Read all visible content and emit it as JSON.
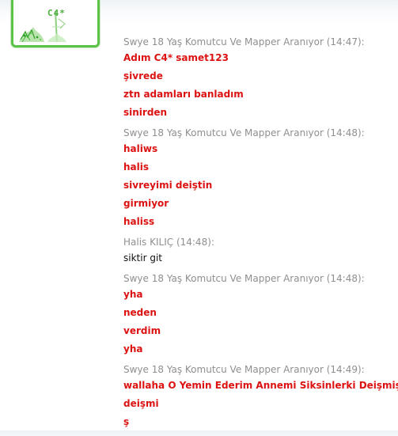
{
  "avatar": {
    "label": "C4*",
    "frame_color": "#5cc24a"
  },
  "colors": {
    "header": "#8f8f8f",
    "red_message": "#dc1212",
    "black_message": "#111111"
  },
  "messages": [
    {
      "header": "Swye 18 Yaş Komutcu Ve Mapper Aranıyor (14:47):",
      "style": "red",
      "lines": [
        "Adım C4* samet123",
        "şivrede",
        "ztn adamları banladım",
        "sinirden"
      ]
    },
    {
      "header": "Swye 18 Yaş Komutcu Ve Mapper Aranıyor (14:48):",
      "style": "red",
      "lines": [
        "haliws",
        "halis",
        "sivreyimi deiştin",
        "girmiyor",
        "haliss"
      ]
    },
    {
      "header": "Halis KILIÇ (14:48):",
      "style": "black",
      "lines": [
        "siktir git"
      ]
    },
    {
      "header": "Swye 18 Yaş Komutcu Ve Mapper Aranıyor (14:48):",
      "style": "red",
      "lines": [
        "yha",
        "neden",
        "verdim",
        "yha"
      ]
    },
    {
      "header": "Swye 18 Yaş Komutcu Ve Mapper Aranıyor (14:49):",
      "style": "red",
      "lines": [
        "wallaha O Yemin Ederim Annemi Siksinlerki Deişmişler",
        "deişmi",
        "ş"
      ]
    }
  ]
}
